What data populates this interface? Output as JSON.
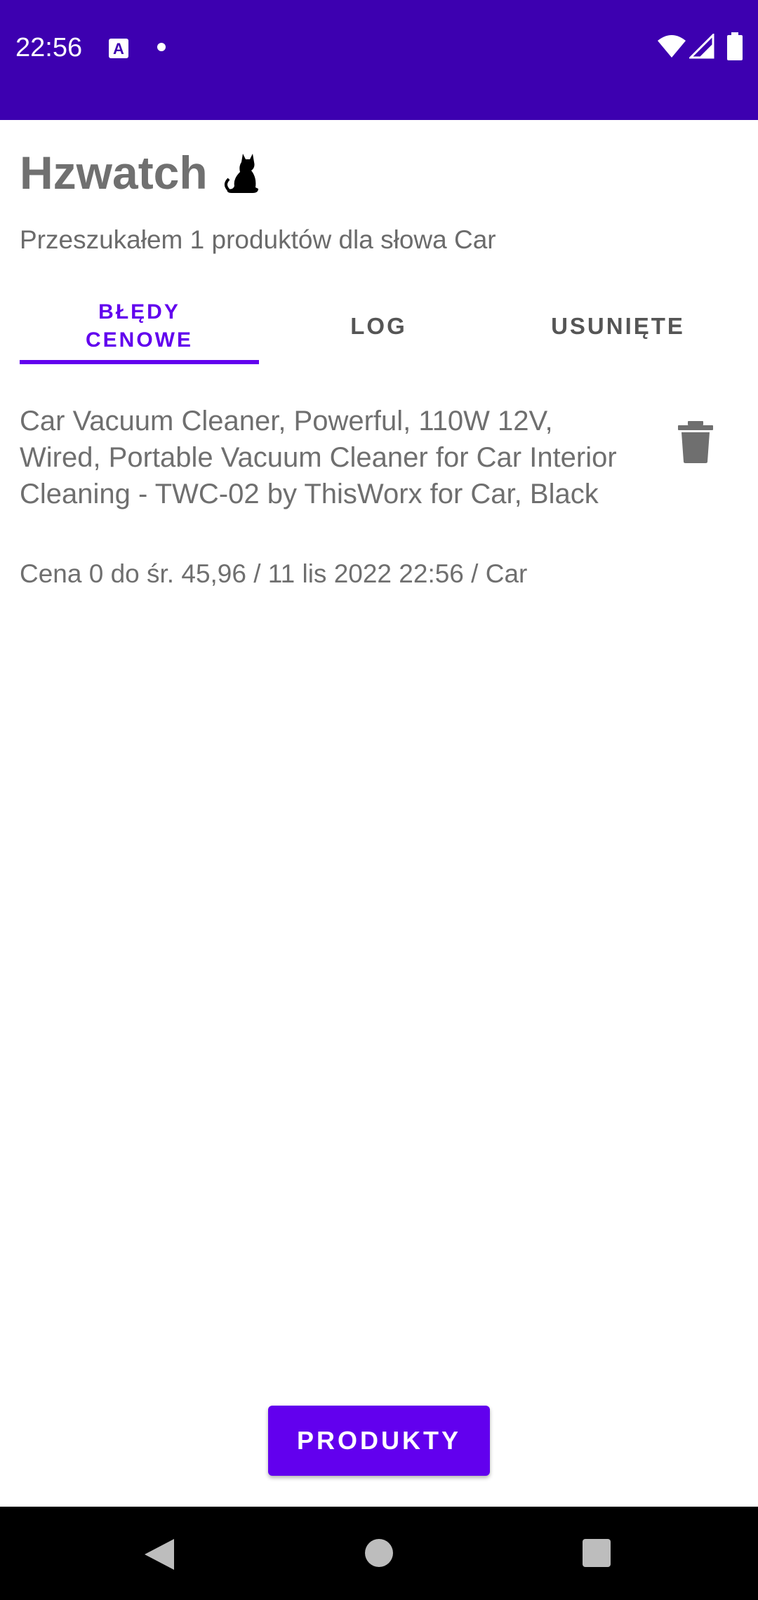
{
  "status_bar": {
    "time": "22:56",
    "icons": [
      "text-a-icon",
      "notification-dot-icon",
      "wifi-icon",
      "signal-icon",
      "battery-icon"
    ],
    "background_color": "#3D00B0"
  },
  "header": {
    "title": "Hzwatch",
    "title_icon": "cat-icon",
    "subtitle": "Przeszukałem 1 produktów dla słowa Car"
  },
  "tabs": [
    {
      "label": "BŁĘDY\nCENOWE",
      "active": true
    },
    {
      "label": "LOG",
      "active": false
    },
    {
      "label": "USUNIĘTE",
      "active": false
    }
  ],
  "items": [
    {
      "title": "Car Vacuum Cleaner, Powerful, 110W 12V, Wired, Portable Vacuum Cleaner for Car Interior Cleaning - TWC-02 by ThisWorx for Car, Black",
      "meta": "Cena 0 do śr. 45,96 / 11 lis 2022 22:56 / Car",
      "action_icon": "trash-icon"
    }
  ],
  "bottom_button": {
    "label": "PRODUKTY"
  },
  "colors": {
    "accent": "#6200EE",
    "status_bar": "#3D00B0",
    "text_secondary": "#6f6f6f"
  },
  "nav_bar": {
    "icons": [
      "back-icon",
      "home-icon",
      "recent-apps-icon"
    ]
  }
}
